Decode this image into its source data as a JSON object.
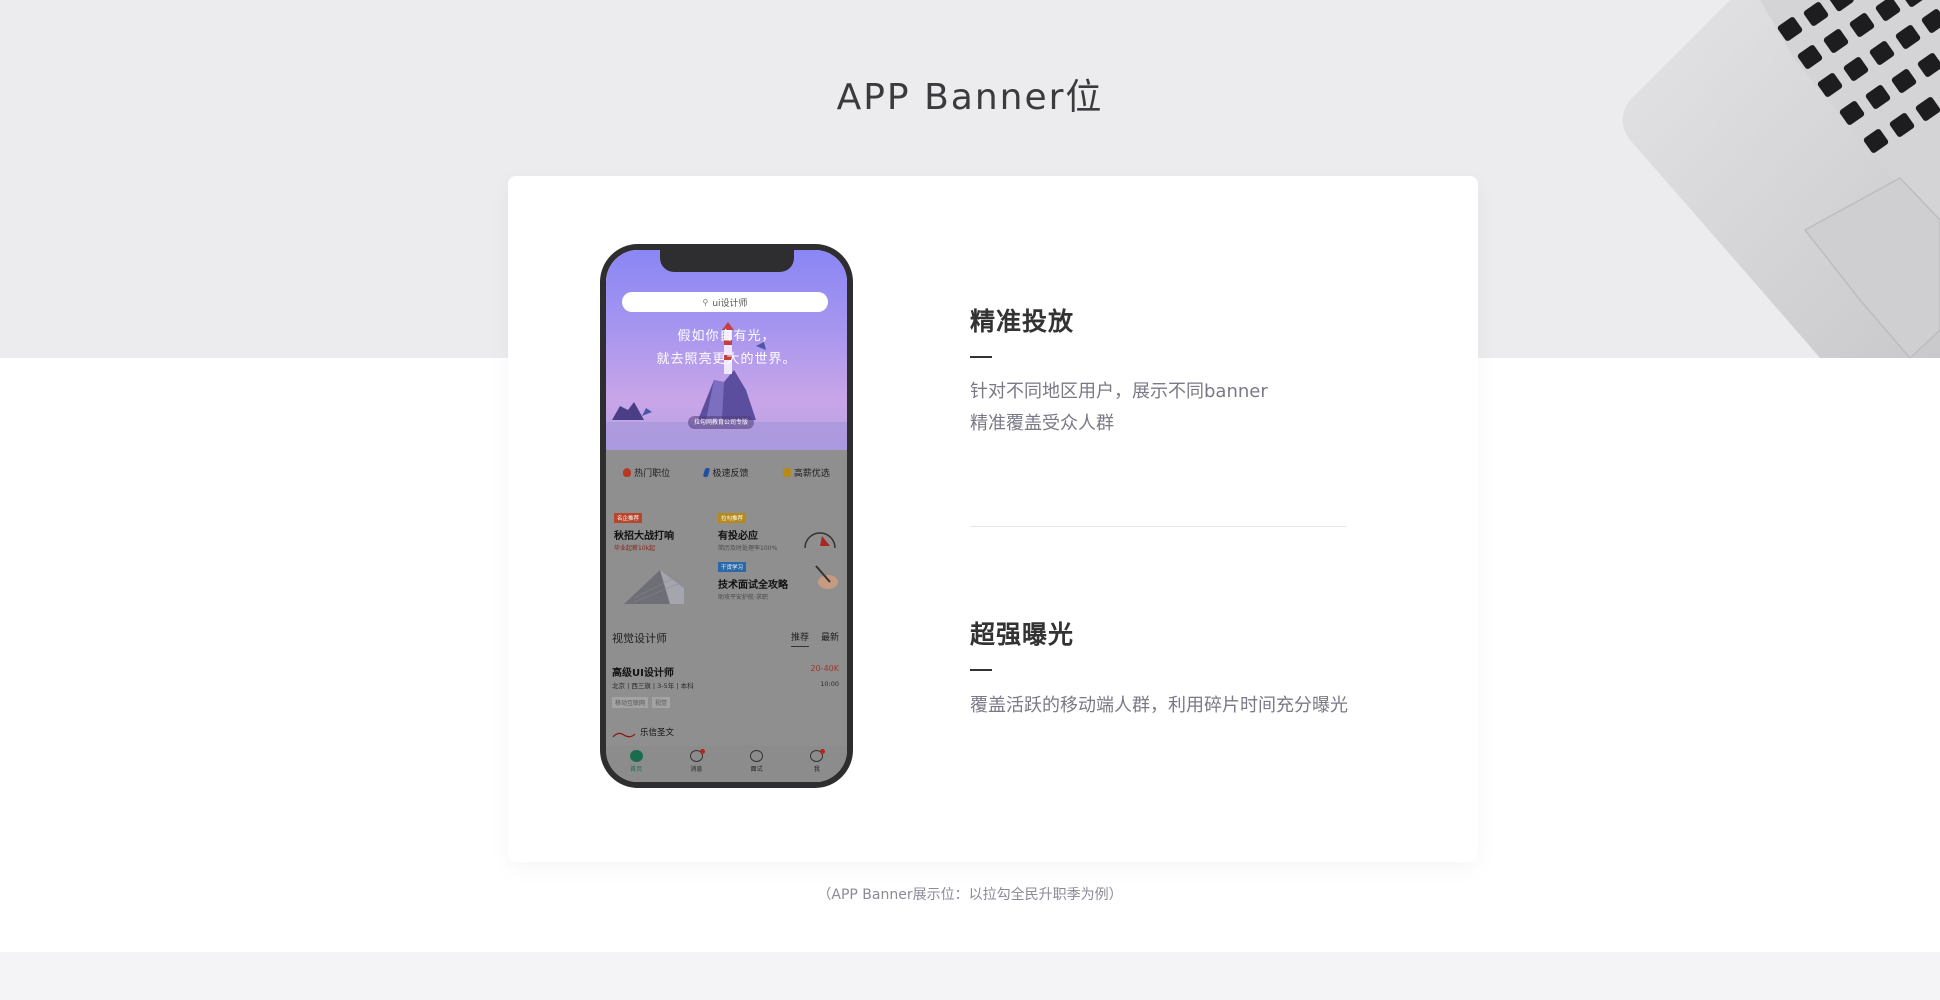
{
  "page": {
    "title": "APP Banner位",
    "footnote": "（APP Banner展示位：以拉勾全民升职季为例）"
  },
  "phone": {
    "search_text": "ui设计师",
    "hero_line1": "假如你自有光，",
    "hero_line2": "就去照亮更大的世界。",
    "hero_caption": "拉勾网教育公司专版",
    "quick_links": [
      {
        "label": "热门职位",
        "color": "#b8381f"
      },
      {
        "label": "极速反馈",
        "color": "#1f4fa0"
      },
      {
        "label": "高薪优选",
        "color": "#b48a1a"
      }
    ],
    "promos": [
      {
        "tag": "名企推荐",
        "tag_color": "#b8462c",
        "title": "秋招大战打响",
        "sub": "毕业起薪10k起",
        "sub_color": "#8a2418"
      },
      {
        "tag": "拉勾推荐",
        "tag_color": "#b48a1a",
        "title": "有投必应",
        "sub": "简历及时处理率100%",
        "sub_color": "#4a4a4a"
      },
      {
        "tag": "干货学习",
        "tag_color": "#2a69a8",
        "title": "技术面试全攻略",
        "sub": "助攻平安护航·求职",
        "sub_color": "#4a4a4a"
      }
    ],
    "section_title": "视觉设计师",
    "section_tabs": [
      "推荐",
      "最新"
    ],
    "job": {
      "title": "高级UI设计师",
      "salary": "20-40K",
      "meta": "北京 | 西三旗 | 3-5年 | 本科",
      "time": "10:00",
      "tags": [
        "移动互联网",
        "视觉"
      ]
    },
    "company": "乐信圣文",
    "tabbar": [
      "首页",
      "消息",
      "面试",
      "我"
    ]
  },
  "features": [
    {
      "title": "精准投放",
      "lines": [
        "针对不同地区用户，展示不同banner",
        "精准覆盖受众人群"
      ]
    },
    {
      "title": "超强曝光",
      "lines": [
        "覆盖活跃的移动端人群，利用碎片时间充分曝光"
      ]
    }
  ]
}
